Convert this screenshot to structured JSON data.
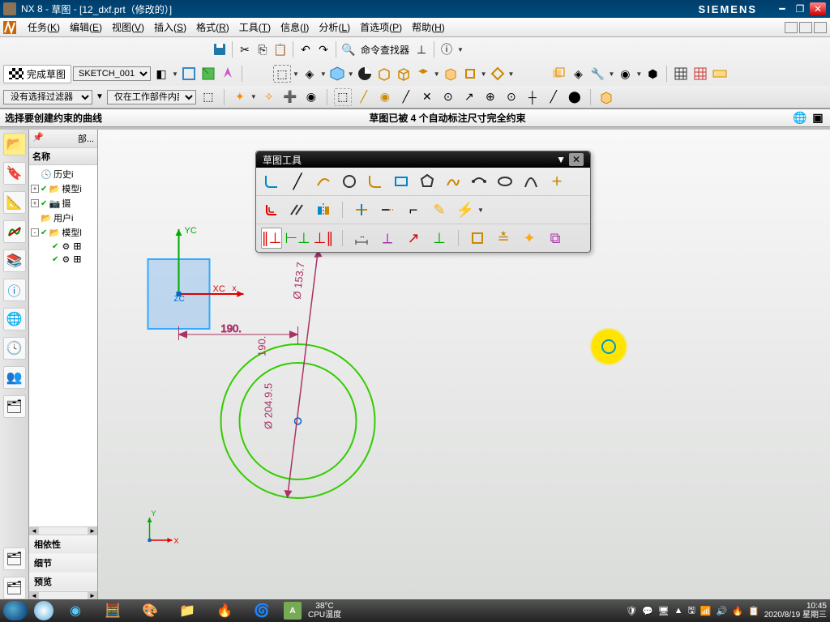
{
  "title_bar": {
    "app": "NX 8",
    "context": "草图",
    "file": "[12_dxf.prt（修改的）]",
    "brand": "SIEMENS"
  },
  "menu": {
    "items": [
      {
        "label": "任务",
        "key": "K"
      },
      {
        "label": "编辑",
        "key": "E"
      },
      {
        "label": "视图",
        "key": "V"
      },
      {
        "label": "插入",
        "key": "S"
      },
      {
        "label": "格式",
        "key": "R"
      },
      {
        "label": "工具",
        "key": "T"
      },
      {
        "label": "信息",
        "key": "I"
      },
      {
        "label": "分析",
        "key": "L"
      },
      {
        "label": "首选项",
        "key": "P"
      },
      {
        "label": "帮助",
        "key": "H"
      }
    ]
  },
  "toolbar1": {
    "cmd_finder": "命令查找器"
  },
  "toolbar2": {
    "finish": "完成草图",
    "sketch_name": "SKETCH_001"
  },
  "filter_bar": {
    "filter": "没有选择过滤器",
    "scope": "仅在工作部件内部"
  },
  "prompt": {
    "left": "选择要创建约束的曲线",
    "center": "草图已被 4 个自动标注尺寸完全约束"
  },
  "nav_panel": {
    "header": "部...",
    "col": "名称",
    "tree": [
      {
        "icon": "🕓",
        "label": "历史i",
        "expand": ""
      },
      {
        "icon": "📂",
        "label": "模型i",
        "expand": "+",
        "check": "✔"
      },
      {
        "icon": "📷",
        "label": "摄",
        "expand": "+",
        "check": "✔"
      },
      {
        "icon": "📂",
        "label": "用户i",
        "expand": ""
      },
      {
        "icon": "📂",
        "label": "模型l",
        "expand": "-",
        "check": "✔"
      },
      {
        "icon": "⚙",
        "label": "𐌎",
        "expand": "",
        "indent": 1,
        "check": "✔"
      },
      {
        "icon": "⚙",
        "label": "𐌎",
        "expand": "",
        "indent": 1,
        "check": "✔"
      }
    ],
    "tabs": [
      "相依性",
      "细节",
      "预览"
    ]
  },
  "sketch_palette": {
    "title": "草图工具"
  },
  "canvas": {
    "dims": {
      "d1": "190.",
      "d2": "190.",
      "dia1": "Ø 204.9.5",
      "dia2": "Ø 153.7"
    },
    "axis": {
      "x": "XC",
      "y": "YC",
      "z": "ZC"
    }
  },
  "taskbar": {
    "temp_c": "38°C",
    "temp_label": "CPU温度",
    "time": "10:45",
    "date": "2020/8/19 星期三"
  }
}
